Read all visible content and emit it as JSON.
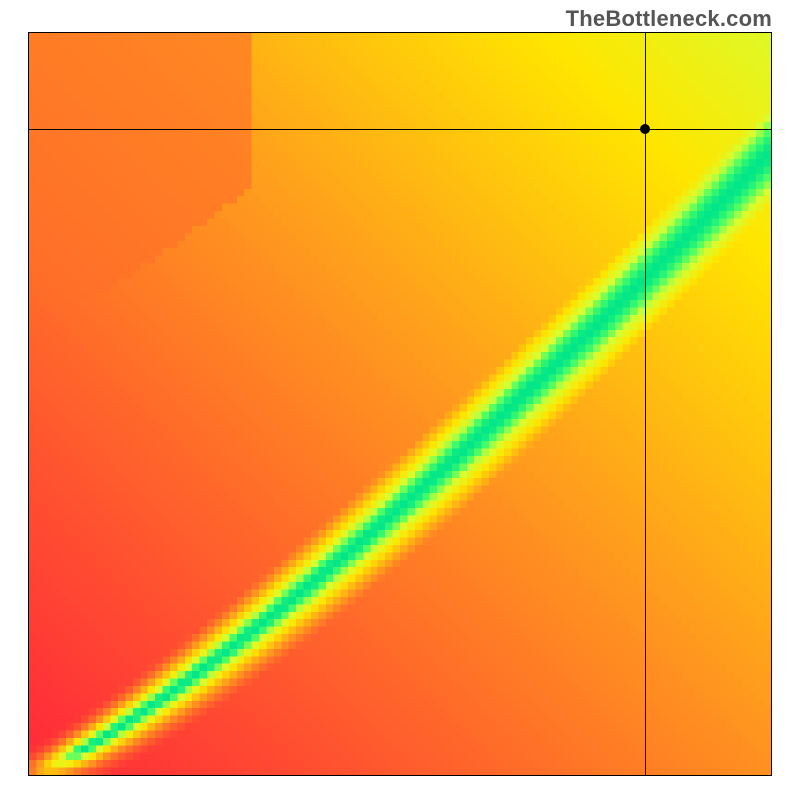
{
  "watermark": "TheBottleneck.com",
  "chart_data": {
    "type": "heatmap",
    "title": "",
    "xlabel": "",
    "ylabel": "",
    "xlim": [
      0,
      100
    ],
    "ylim": [
      0,
      100
    ],
    "grid": false,
    "resolution": 100,
    "pixelated": true,
    "description": "Bottleneck compatibility heatmap. Two normalized component scores (0-100) on X and Y; green band along a slightly super-linear diagonal indicates balanced pairing, yellow = mild bottleneck, red/orange = severe bottleneck. Crosshair marks the queried pair.",
    "color_stops": [
      {
        "t": 0.0,
        "color": "#ff2a3a"
      },
      {
        "t": 0.4,
        "color": "#ff9b1e"
      },
      {
        "t": 0.65,
        "color": "#ffe600"
      },
      {
        "t": 0.82,
        "color": "#d6ff33"
      },
      {
        "t": 0.92,
        "color": "#4bff66"
      },
      {
        "t": 1.0,
        "color": "#00e68a"
      }
    ],
    "band": {
      "center_exponent": 1.22,
      "center_scale": 0.84,
      "width_base": 0.018,
      "width_growth": 0.1,
      "falloff_shape": 0.9
    },
    "gradient_field": {
      "reference_corner": "bottom-right-warm",
      "max_off_band": 0.78
    },
    "crosshair": {
      "x": 83.0,
      "y": 87.0
    },
    "marker": {
      "x": 83.0,
      "y": 87.0
    }
  }
}
